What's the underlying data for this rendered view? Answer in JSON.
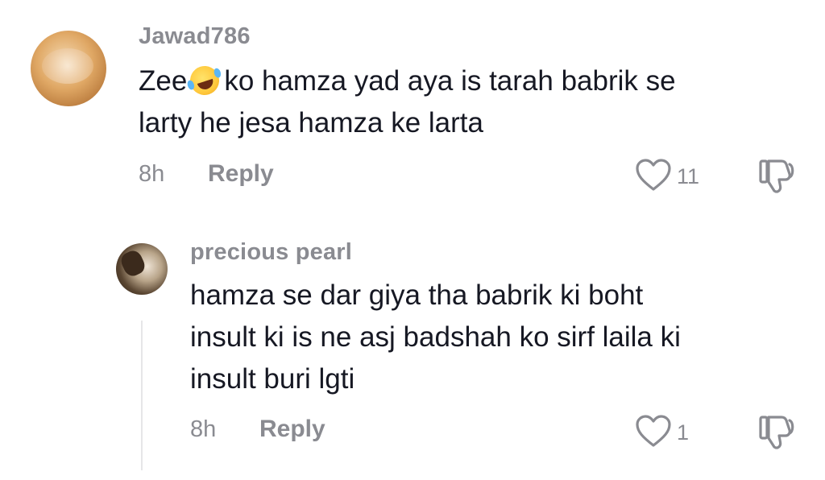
{
  "comments": [
    {
      "username": "Jawad786",
      "text_line1_before": "Zee",
      "text_line1_after": "ko hamza yad aya is tarah babrik se",
      "text_line2": "larty he jesa hamza ke larta",
      "emoji_icon": "rolling-on-floor-laughing-emoji",
      "time": "8h",
      "reply_label": "Reply",
      "like_count": "11"
    },
    {
      "username": "precious pearl",
      "text_line1": "hamza se dar giya tha babrik ki boht",
      "text_line2": "insult ki is ne asj badshah ko sirf laila ki",
      "text_line3": "insult buri lgti",
      "time": "8h",
      "reply_label": "Reply",
      "like_count": "1"
    }
  ],
  "colors": {
    "text": "#161823",
    "muted": "#8a8b91",
    "thread_line": "#e6e6e8"
  }
}
